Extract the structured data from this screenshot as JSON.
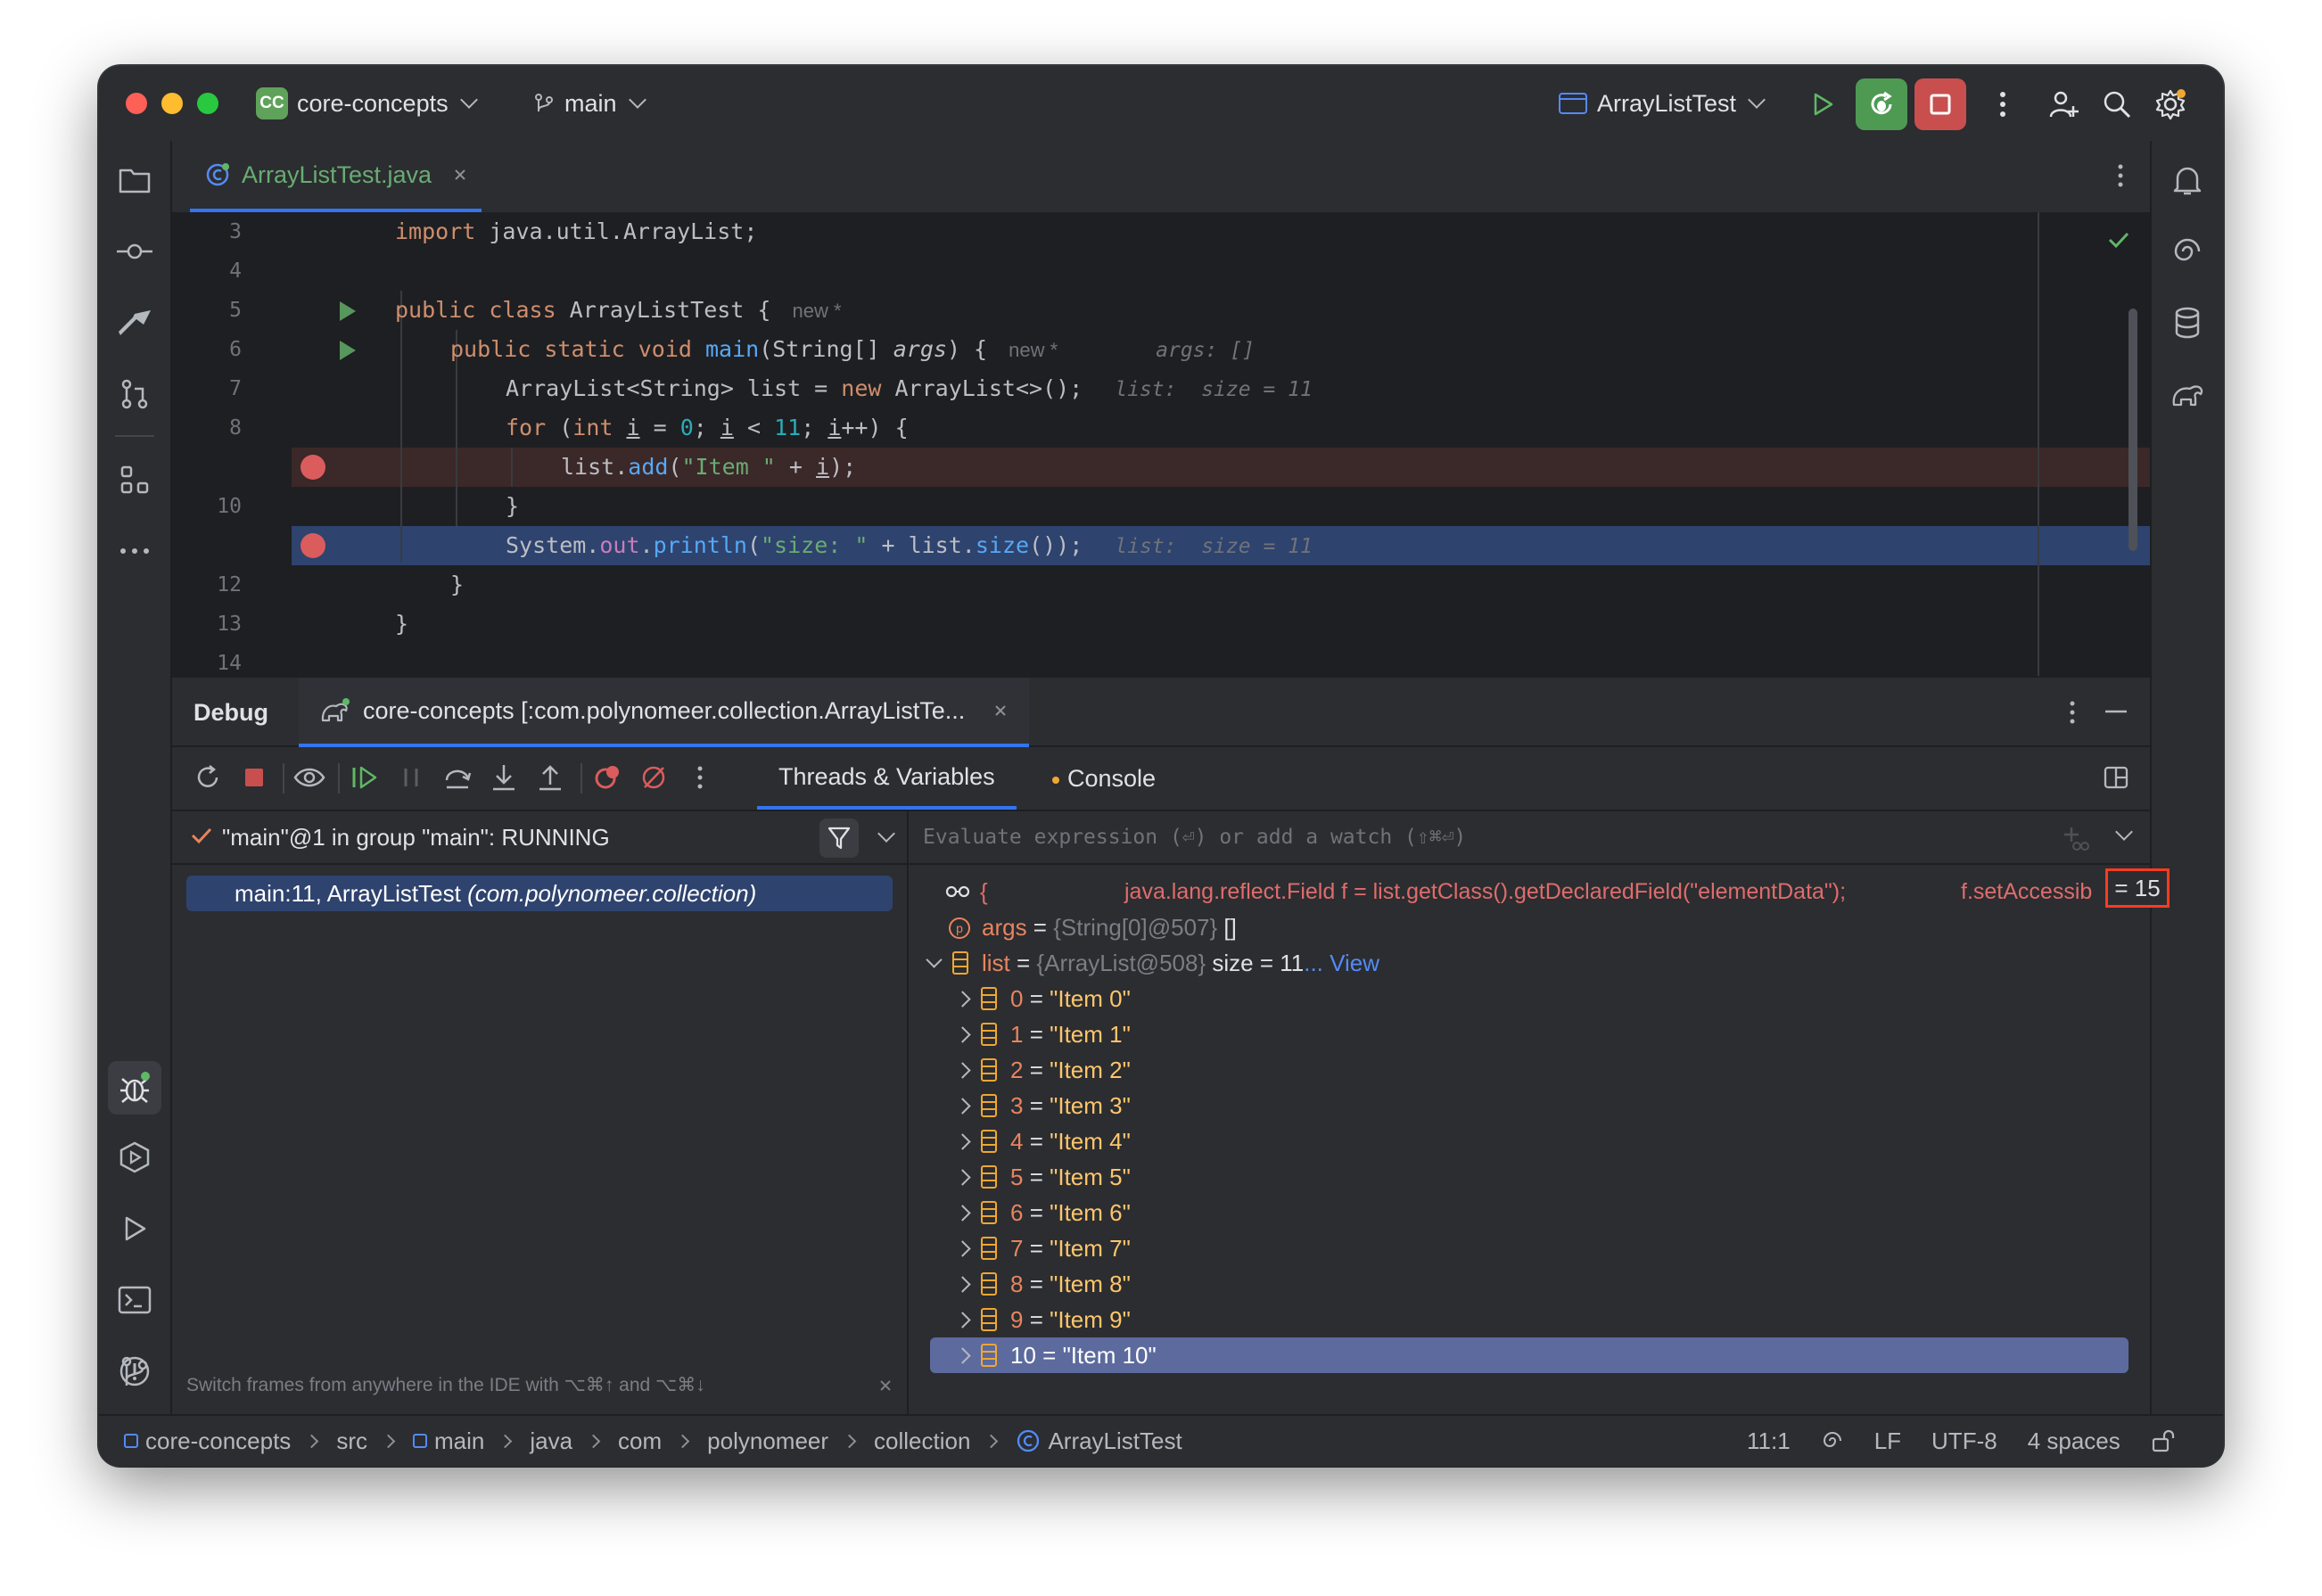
{
  "titlebar": {
    "project_badge": "CC",
    "project_name": "core-concepts",
    "branch": "main",
    "run_config": "ArrayListTest"
  },
  "editor": {
    "tab_label": "ArrayListTest.java",
    "lines": [
      {
        "n": "3"
      },
      {
        "n": "4"
      },
      {
        "n": "5"
      },
      {
        "n": "6"
      },
      {
        "n": "7"
      },
      {
        "n": "8"
      },
      {
        "n": ""
      },
      {
        "n": "10"
      },
      {
        "n": ""
      },
      {
        "n": "12"
      },
      {
        "n": "13"
      },
      {
        "n": "14"
      }
    ],
    "code": {
      "l3_kw": "import",
      "l3_rest": " java.util.ArrayList;",
      "l5_kw": "public class",
      "l5_cls": " ArrayListTest ",
      "l5_brace": "{",
      "l5_hint": "new *",
      "l6_kw": "public static void",
      "l6_fn": " main",
      "l6_a": "(String[] ",
      "l6_param": "args",
      "l6_b": ") {",
      "l6_hint": "new *",
      "l6_ihint": "args: []",
      "l7_a": "ArrayList<String> list = ",
      "l7_kw": "new",
      "l7_b": " ArrayList<>();",
      "l7_ihint": "list:  size = 11",
      "l8_kw": "for",
      "l8_a": " (",
      "l8_kw2": "int",
      "l8_sp": " ",
      "l8_i1": "i",
      "l8_b": " = ",
      "l8_n0": "0",
      "l8_c": "; ",
      "l8_i2": "i",
      "l8_d": " < ",
      "l8_n11": "11",
      "l8_e": "; ",
      "l8_i3": "i",
      "l8_f": "++) {",
      "l9_a": "list.",
      "l9_fn": "add",
      "l9_b": "(",
      "l9_str": "\"Item \"",
      "l9_c": " + ",
      "l9_i": "i",
      "l9_d": ");",
      "l10": "}",
      "l11_a": "System.",
      "l11_fld": "out",
      "l11_b": ".",
      "l11_fn": "println",
      "l11_c": "(",
      "l11_str": "\"size: \"",
      "l11_d": " + list.",
      "l11_fn2": "size",
      "l11_e": "());",
      "l11_ihint": "list:  size = 11",
      "l12": "}",
      "l13": "}"
    }
  },
  "debug": {
    "panel_title": "Debug",
    "session_tab": "core-concepts [:com.polynomeer.collection.ArrayListTe...",
    "tabs": [
      "Threads & Variables",
      "Console"
    ],
    "thread_status": "\"main\"@1 in group \"main\": RUNNING",
    "frame": "main:11, ArrayListTest",
    "frame_pkg": "(com.polynomeer.collection)",
    "frames_hint": "Switch frames from anywhere in the IDE with ⌥⌘↑ and ⌥⌘↓",
    "eval_placeholder": "Evaluate expression (⏎) or add a watch (⇧⌘⏎)",
    "watch": {
      "prefix": "{",
      "expr1": "java.lang.reflect.Field f = list.getClass().getDeclaredField(\"elementData\");",
      "expr2": "f.setAccessib",
      "result": "= 15"
    },
    "args": {
      "name": "args",
      "eq": " = ",
      "type": "{String[0]@507}",
      "value": " []"
    },
    "list": {
      "name": "list",
      "eq": " = ",
      "type": "{ArrayList@508}",
      "size": " size = 11",
      "view": "... View"
    },
    "items": [
      {
        "idx": "0",
        "val": "\"Item 0\""
      },
      {
        "idx": "1",
        "val": "\"Item 1\""
      },
      {
        "idx": "2",
        "val": "\"Item 2\""
      },
      {
        "idx": "3",
        "val": "\"Item 3\""
      },
      {
        "idx": "4",
        "val": "\"Item 4\""
      },
      {
        "idx": "5",
        "val": "\"Item 5\""
      },
      {
        "idx": "6",
        "val": "\"Item 6\""
      },
      {
        "idx": "7",
        "val": "\"Item 7\""
      },
      {
        "idx": "8",
        "val": "\"Item 8\""
      },
      {
        "idx": "9",
        "val": "\"Item 9\""
      },
      {
        "idx": "10",
        "val": "\"Item 10\""
      }
    ]
  },
  "status": {
    "breadcrumbs": [
      "core-concepts",
      "src",
      "main",
      "java",
      "com",
      "polynomeer",
      "collection",
      "ArrayListTest"
    ],
    "position": "11:1",
    "line_sep": "LF",
    "encoding": "UTF-8",
    "indent": "4 spaces"
  },
  "colors": {
    "accent": "#3574f0",
    "breakpoint": "#db5c5c",
    "selected_line": "#2e436e",
    "variable_name": "#e8845f",
    "string": "#ffc66d"
  }
}
